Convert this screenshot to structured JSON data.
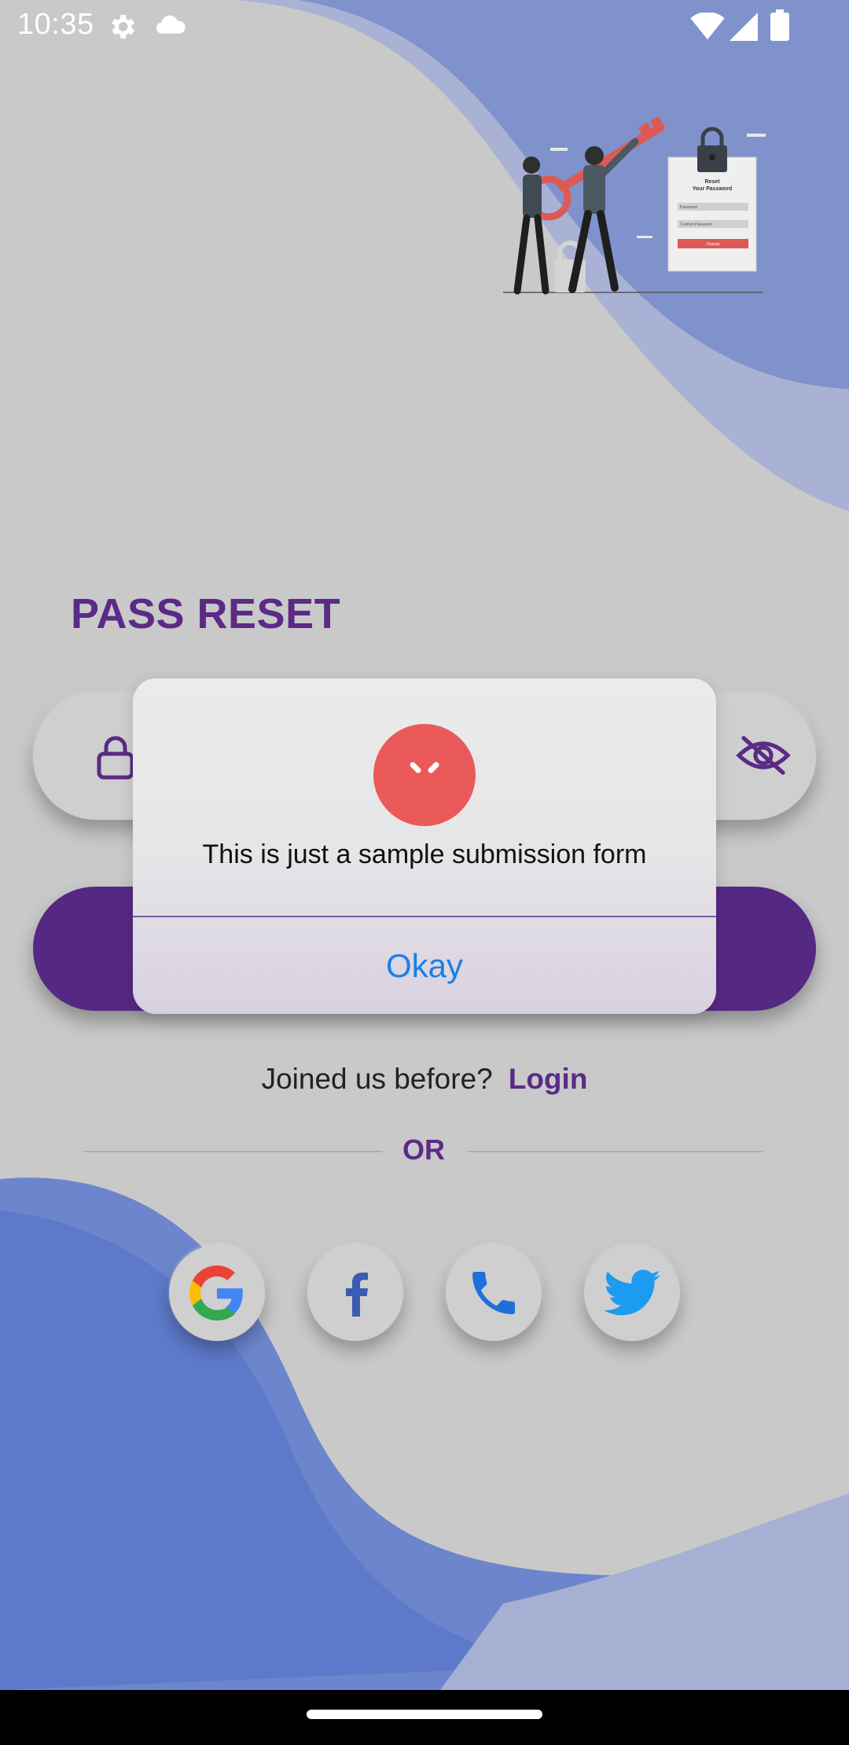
{
  "status_bar": {
    "time": "10:35",
    "icons": [
      "settings-icon",
      "cloud-icon",
      "wifi-icon",
      "signal-icon",
      "battery-icon"
    ]
  },
  "page": {
    "title": "PASS RESET",
    "joined_prompt": "Joined us before?",
    "login_label": "Login",
    "or_label": "OR"
  },
  "illustration": {
    "card_title_line1": "Reset",
    "card_title_line2": "Your Password",
    "card_field1": "Password",
    "card_field2": "Confirm Password",
    "card_button": "Change"
  },
  "password_field": {
    "left_icon": "lock-icon",
    "right_icon": "eye-off-icon"
  },
  "social_buttons": [
    "google-icon",
    "facebook-icon",
    "phone-icon",
    "twitter-icon"
  ],
  "dialog": {
    "message": "This is just a sample submission form",
    "button_label": "Okay",
    "icon": "error-icon"
  },
  "colors": {
    "accent": "#5b2a86",
    "button": "#552883",
    "link": "#1b7ee8",
    "error": "#ea5a5a",
    "background": "#c9c9c9",
    "wave": "#5b77cc"
  }
}
